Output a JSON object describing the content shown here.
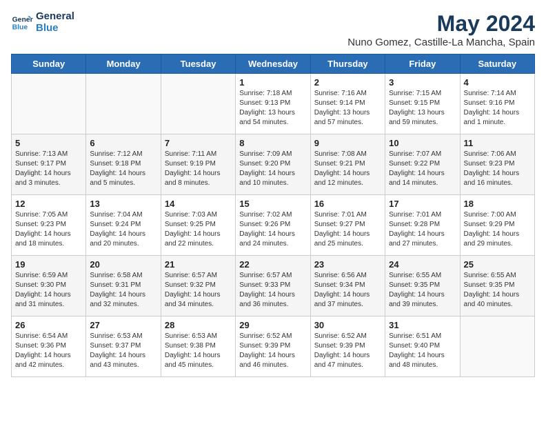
{
  "header": {
    "logo_line1": "General",
    "logo_line2": "Blue",
    "month_year": "May 2024",
    "location": "Nuno Gomez, Castille-La Mancha, Spain"
  },
  "weekdays": [
    "Sunday",
    "Monday",
    "Tuesday",
    "Wednesday",
    "Thursday",
    "Friday",
    "Saturday"
  ],
  "weeks": [
    [
      {
        "day": "",
        "info": ""
      },
      {
        "day": "",
        "info": ""
      },
      {
        "day": "",
        "info": ""
      },
      {
        "day": "1",
        "info": "Sunrise: 7:18 AM\nSunset: 9:13 PM\nDaylight: 13 hours\nand 54 minutes."
      },
      {
        "day": "2",
        "info": "Sunrise: 7:16 AM\nSunset: 9:14 PM\nDaylight: 13 hours\nand 57 minutes."
      },
      {
        "day": "3",
        "info": "Sunrise: 7:15 AM\nSunset: 9:15 PM\nDaylight: 13 hours\nand 59 minutes."
      },
      {
        "day": "4",
        "info": "Sunrise: 7:14 AM\nSunset: 9:16 PM\nDaylight: 14 hours\nand 1 minute."
      }
    ],
    [
      {
        "day": "5",
        "info": "Sunrise: 7:13 AM\nSunset: 9:17 PM\nDaylight: 14 hours\nand 3 minutes."
      },
      {
        "day": "6",
        "info": "Sunrise: 7:12 AM\nSunset: 9:18 PM\nDaylight: 14 hours\nand 5 minutes."
      },
      {
        "day": "7",
        "info": "Sunrise: 7:11 AM\nSunset: 9:19 PM\nDaylight: 14 hours\nand 8 minutes."
      },
      {
        "day": "8",
        "info": "Sunrise: 7:09 AM\nSunset: 9:20 PM\nDaylight: 14 hours\nand 10 minutes."
      },
      {
        "day": "9",
        "info": "Sunrise: 7:08 AM\nSunset: 9:21 PM\nDaylight: 14 hours\nand 12 minutes."
      },
      {
        "day": "10",
        "info": "Sunrise: 7:07 AM\nSunset: 9:22 PM\nDaylight: 14 hours\nand 14 minutes."
      },
      {
        "day": "11",
        "info": "Sunrise: 7:06 AM\nSunset: 9:23 PM\nDaylight: 14 hours\nand 16 minutes."
      }
    ],
    [
      {
        "day": "12",
        "info": "Sunrise: 7:05 AM\nSunset: 9:23 PM\nDaylight: 14 hours\nand 18 minutes."
      },
      {
        "day": "13",
        "info": "Sunrise: 7:04 AM\nSunset: 9:24 PM\nDaylight: 14 hours\nand 20 minutes."
      },
      {
        "day": "14",
        "info": "Sunrise: 7:03 AM\nSunset: 9:25 PM\nDaylight: 14 hours\nand 22 minutes."
      },
      {
        "day": "15",
        "info": "Sunrise: 7:02 AM\nSunset: 9:26 PM\nDaylight: 14 hours\nand 24 minutes."
      },
      {
        "day": "16",
        "info": "Sunrise: 7:01 AM\nSunset: 9:27 PM\nDaylight: 14 hours\nand 25 minutes."
      },
      {
        "day": "17",
        "info": "Sunrise: 7:01 AM\nSunset: 9:28 PM\nDaylight: 14 hours\nand 27 minutes."
      },
      {
        "day": "18",
        "info": "Sunrise: 7:00 AM\nSunset: 9:29 PM\nDaylight: 14 hours\nand 29 minutes."
      }
    ],
    [
      {
        "day": "19",
        "info": "Sunrise: 6:59 AM\nSunset: 9:30 PM\nDaylight: 14 hours\nand 31 minutes."
      },
      {
        "day": "20",
        "info": "Sunrise: 6:58 AM\nSunset: 9:31 PM\nDaylight: 14 hours\nand 32 minutes."
      },
      {
        "day": "21",
        "info": "Sunrise: 6:57 AM\nSunset: 9:32 PM\nDaylight: 14 hours\nand 34 minutes."
      },
      {
        "day": "22",
        "info": "Sunrise: 6:57 AM\nSunset: 9:33 PM\nDaylight: 14 hours\nand 36 minutes."
      },
      {
        "day": "23",
        "info": "Sunrise: 6:56 AM\nSunset: 9:34 PM\nDaylight: 14 hours\nand 37 minutes."
      },
      {
        "day": "24",
        "info": "Sunrise: 6:55 AM\nSunset: 9:35 PM\nDaylight: 14 hours\nand 39 minutes."
      },
      {
        "day": "25",
        "info": "Sunrise: 6:55 AM\nSunset: 9:35 PM\nDaylight: 14 hours\nand 40 minutes."
      }
    ],
    [
      {
        "day": "26",
        "info": "Sunrise: 6:54 AM\nSunset: 9:36 PM\nDaylight: 14 hours\nand 42 minutes."
      },
      {
        "day": "27",
        "info": "Sunrise: 6:53 AM\nSunset: 9:37 PM\nDaylight: 14 hours\nand 43 minutes."
      },
      {
        "day": "28",
        "info": "Sunrise: 6:53 AM\nSunset: 9:38 PM\nDaylight: 14 hours\nand 45 minutes."
      },
      {
        "day": "29",
        "info": "Sunrise: 6:52 AM\nSunset: 9:39 PM\nDaylight: 14 hours\nand 46 minutes."
      },
      {
        "day": "30",
        "info": "Sunrise: 6:52 AM\nSunset: 9:39 PM\nDaylight: 14 hours\nand 47 minutes."
      },
      {
        "day": "31",
        "info": "Sunrise: 6:51 AM\nSunset: 9:40 PM\nDaylight: 14 hours\nand 48 minutes."
      },
      {
        "day": "",
        "info": ""
      }
    ]
  ]
}
